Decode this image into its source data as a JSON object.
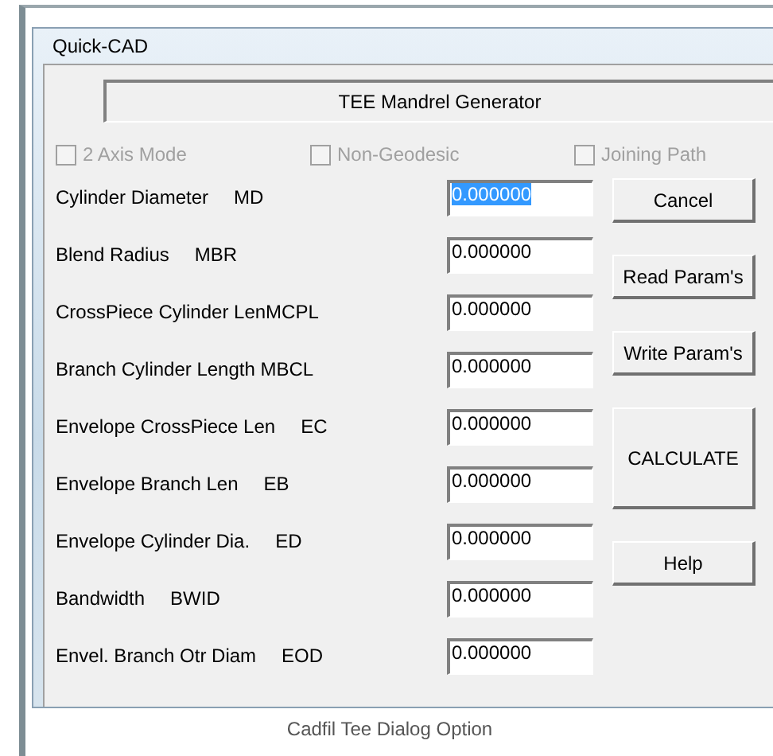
{
  "window": {
    "title": "Quick-CAD"
  },
  "header": "TEE Mandrel Generator",
  "options": [
    {
      "label": "2 Axis Mode",
      "checked": false,
      "disabled": true
    },
    {
      "label": "Non-Geodesic",
      "checked": false,
      "disabled": true
    },
    {
      "label": "Joining Path",
      "checked": false,
      "disabled": true
    }
  ],
  "parameters": [
    {
      "label": "Cylinder Diameter",
      "code": "MD",
      "value": "0.000000",
      "focused": true
    },
    {
      "label": "Blend Radius",
      "code": "MBR",
      "value": "0.000000",
      "focused": false
    },
    {
      "label": "CrossPiece Cylinder LenMCPL",
      "value": "0.000000",
      "focused": false
    },
    {
      "label": "Branch Cylinder Length MBCL",
      "value": "0.000000",
      "focused": false
    },
    {
      "label": "Envelope CrossPiece Len",
      "code": "EC",
      "value": "0.000000",
      "focused": false
    },
    {
      "label": "Envelope Branch Len",
      "code": "EB",
      "value": "0.000000",
      "focused": false
    },
    {
      "label": "Envelope Cylinder Dia.",
      "code": "ED",
      "value": "0.000000",
      "focused": false
    },
    {
      "label": "Bandwidth",
      "code": "BWID",
      "value": "0.000000",
      "focused": false
    },
    {
      "label": "Envel. Branch Otr Diam",
      "code": "EOD",
      "value": "0.000000",
      "focused": false
    }
  ],
  "buttons": [
    {
      "label": "Cancel",
      "kind": "normal"
    },
    {
      "label": "Read Param's",
      "kind": "normal"
    },
    {
      "label": "Write Param's",
      "kind": "normal"
    },
    {
      "label": "CALCULATE",
      "kind": "tall"
    },
    {
      "label": "Help",
      "kind": "normal"
    }
  ],
  "caption": "Cadfil Tee Dialog Option"
}
